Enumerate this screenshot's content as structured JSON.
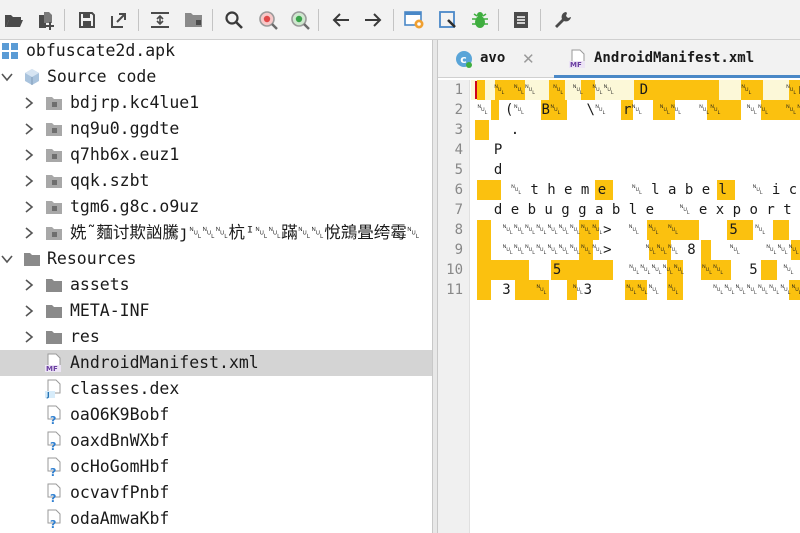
{
  "toolbar": {
    "buttons": [
      {
        "name": "open-file-icon"
      },
      {
        "name": "add-files-icon"
      },
      {
        "name": "save-all-icon"
      },
      {
        "name": "export-icon"
      },
      {
        "name": "sync-tree-icon"
      },
      {
        "name": "flatten-packages-icon"
      },
      {
        "name": "search-icon"
      },
      {
        "name": "find-class-icon"
      },
      {
        "name": "find-usage-icon"
      },
      {
        "name": "back-icon"
      },
      {
        "name": "forward-icon"
      },
      {
        "name": "quark-engine-icon"
      },
      {
        "name": "deobfuscation-icon"
      },
      {
        "name": "debugger-icon"
      },
      {
        "name": "log-viewer-icon"
      },
      {
        "name": "preferences-icon"
      }
    ]
  },
  "tree": {
    "root": "obfuscate2d.apk",
    "source_code": "Source code",
    "packages": [
      "bdjrp.kc4lue1",
      "nq9u0.ggdte",
      "q7hb6x.euz1",
      "qqk.szbt",
      "tgm6.g8c.o9uz",
      "姺˜麵讨欺訩騰ȷ␀␀␀杭ᴵ␀␀蹣␀␀悅鵍畳绔霉␀"
    ],
    "resources": "Resources",
    "folders": [
      "assets",
      "META-INF",
      "res"
    ],
    "files": [
      {
        "label": "AndroidManifest.xml",
        "icon": "manifest-file-icon",
        "badge": "MF",
        "selected": true
      },
      {
        "label": "classes.dex",
        "icon": "dex-file-icon",
        "badge": "J"
      },
      {
        "label": "oaO6K9Bobf",
        "icon": "unknown-file-icon",
        "badge": "?"
      },
      {
        "label": "oaxdBnWXbf",
        "icon": "unknown-file-icon",
        "badge": "?"
      },
      {
        "label": "ocHoGomHbf",
        "icon": "unknown-file-icon",
        "badge": "?"
      },
      {
        "label": "ocvavfPnbf",
        "icon": "unknown-file-icon",
        "badge": "?"
      },
      {
        "label": "odaAmwaKbf",
        "icon": "unknown-file-icon",
        "badge": "?"
      }
    ]
  },
  "editor": {
    "tabs": [
      {
        "label": "avo",
        "icon": "class-icon",
        "badge": "c",
        "active": false
      },
      {
        "label": "AndroidManifest.xml",
        "icon": "manifest-file-icon",
        "badge": "MF",
        "active": true
      }
    ],
    "close_glyph": "✕",
    "line_numbers": [
      "1",
      "2",
      "3",
      "4",
      "5",
      "6",
      "7",
      "8",
      "9",
      "10",
      "11"
    ],
    "lines": [
      "  ␀ ␀␀  ␀ ␀ ␀␀   D           ␀    ␀r␀",
      "␀  (␀  B␀   \\␀  r␀  ␀␀  ␀␀   ␀␀  ␀␀  ␀␀",
      "    .",
      "  P",
      "  d",
      "    ␀ t h e m e   ␀ l a b e l   ␀ i c o",
      "  d e b u g g a b l e   ␀ e x p o r t",
      "   ␀␀␀␀␀␀␀␀␀>  ␀ ␀ ␀      5  ␀    )",
      "   ␀␀␀␀␀␀␀␀␀>    ␀␀␀ 8    ␀   ␀␀␀␀␀␀␀␀␀>",
      "         5        ␀␀␀␀␀  ␀␀   5   ␀  @",
      "   3   ␀   ␀3    ␀␀␀ ␀    ␀␀␀␀␀␀␀␀8"
    ]
  },
  "colors": {
    "highlight": "#fbc10f",
    "selection": "#d4d4d4",
    "tab_underline": "#4a88c7",
    "caret": "#d0021b",
    "current_line": "#fcf8d8"
  }
}
